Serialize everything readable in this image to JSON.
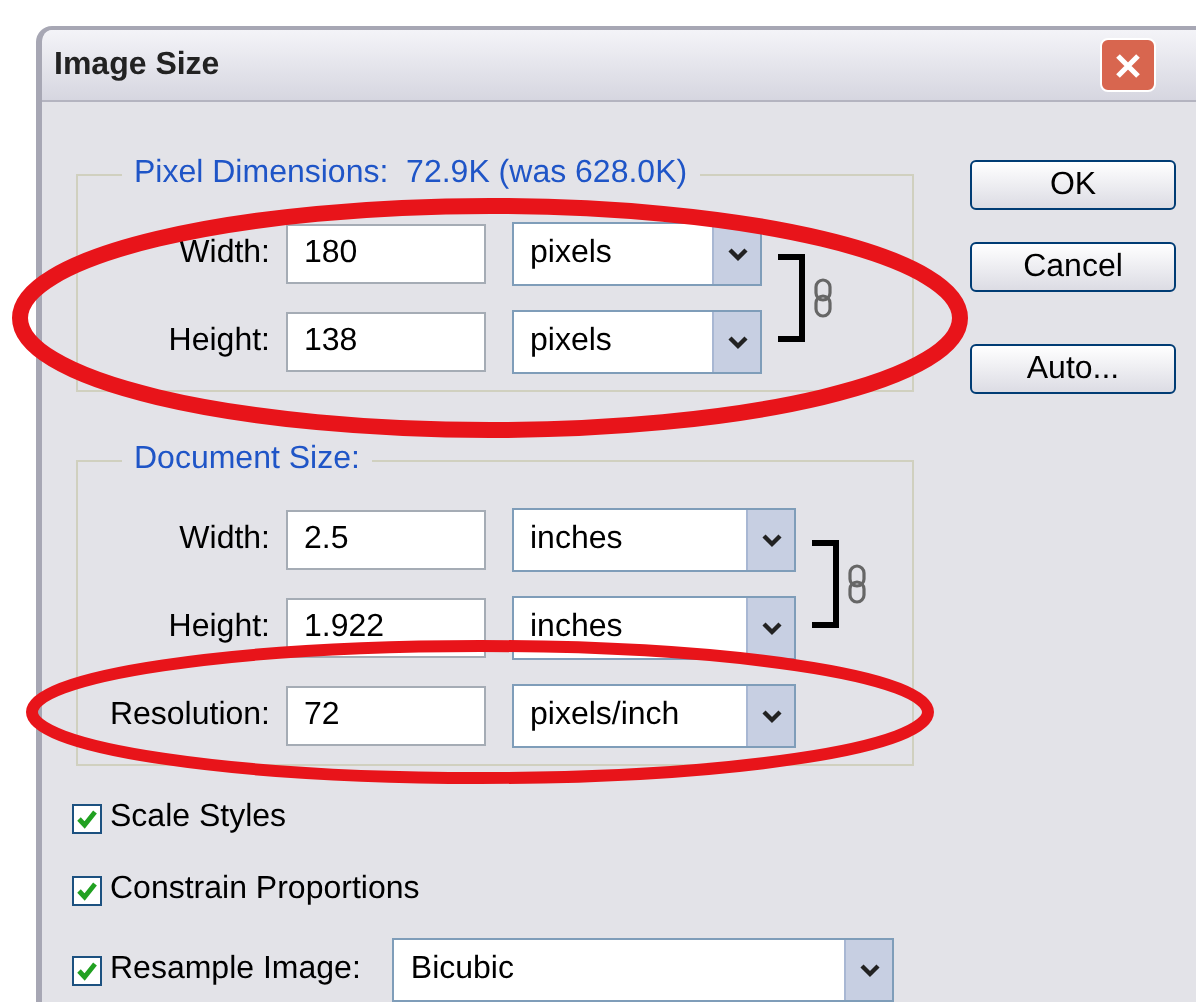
{
  "window": {
    "title": "Image Size"
  },
  "pixel_dimensions": {
    "heading": "Pixel Dimensions:  72.9K (was 628.0K)",
    "linked": true,
    "fields": [
      {
        "label": "Width:",
        "value": "180",
        "unit": "pixels"
      },
      {
        "label": "Height:",
        "value": "138",
        "unit": "pixels"
      }
    ]
  },
  "document_size": {
    "heading": "Document Size:",
    "linked": true,
    "fields": [
      {
        "label": "Width:",
        "value": "2.5",
        "unit": "inches"
      },
      {
        "label": "Height:",
        "value": "1.922",
        "unit": "inches"
      },
      {
        "label": "Resolution:",
        "value": "72",
        "unit": "pixels/inch"
      }
    ]
  },
  "buttons": [
    "OK",
    "Cancel",
    "Auto..."
  ],
  "options": [
    {
      "label": "Scale Styles",
      "checked": true
    },
    {
      "label": "Constrain Proportions",
      "checked": true
    },
    {
      "label": "Resample Image:",
      "checked": true,
      "value": "Bicubic"
    }
  ]
}
